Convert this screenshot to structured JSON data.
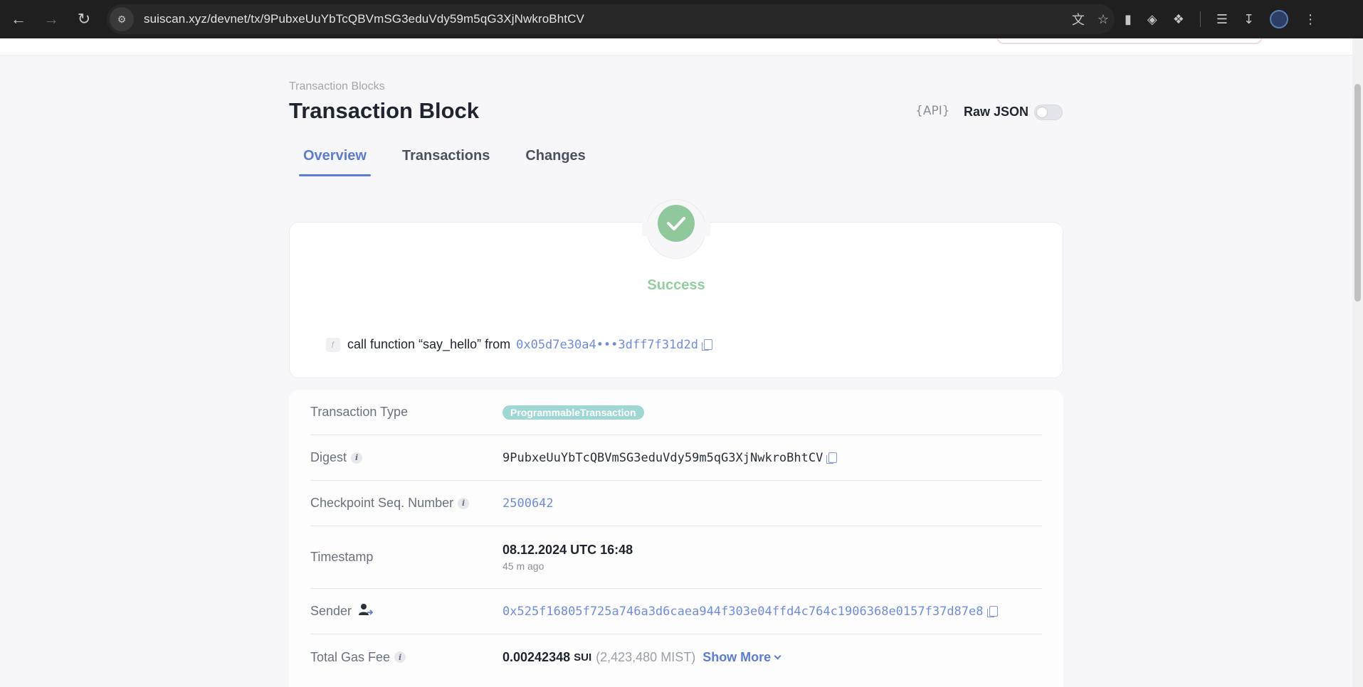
{
  "browser": {
    "url": "suiscan.xyz/devnet/tx/9PubxeUuYbTcQBVmSG3eduVdy59m5qG3XjNwkroBhtCV"
  },
  "header": {
    "breadcrumb": "Transaction Blocks",
    "title": "Transaction Block",
    "api_label": "{API}",
    "raw_json_label": "Raw JSON",
    "raw_json_enabled": false
  },
  "tabs": [
    {
      "label": "Overview",
      "active": true
    },
    {
      "label": "Transactions",
      "active": false
    },
    {
      "label": "Changes",
      "active": false
    }
  ],
  "status": {
    "text": "Success",
    "call_text": "call function “say_hello” from",
    "package_address": "0x05d7e30a4•••3dff7f31d2d"
  },
  "details": {
    "transaction_type": {
      "label": "Transaction Type",
      "value": "ProgrammableTransaction"
    },
    "digest": {
      "label": "Digest",
      "value": "9PubxeUuYbTcQBVmSG3eduVdy59m5qG3XjNwkroBhtCV"
    },
    "checkpoint": {
      "label": "Checkpoint Seq. Number",
      "value": "2500642"
    },
    "timestamp": {
      "label": "Timestamp",
      "value": "08.12.2024 UTC 16:48",
      "relative": "45 m ago"
    },
    "sender": {
      "label": "Sender",
      "value": "0x525f16805f725a746a3d6caea944f303e04ffd4c764c1906368e0157f37d87e8"
    },
    "gas_fee": {
      "label": "Total Gas Fee",
      "amount": "0.00242348",
      "unit": "SUI",
      "mist": "(2,423,480 MIST)",
      "show_more": "Show More"
    }
  },
  "colors": {
    "accent": "#5b7bd5",
    "success": "#8fc99b",
    "badge": "#9fd8d2"
  }
}
